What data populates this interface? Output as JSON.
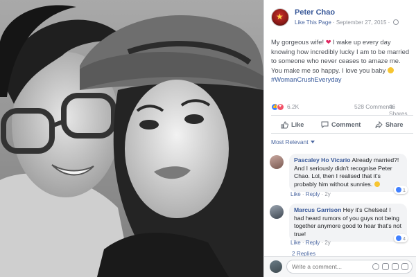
{
  "photo": {
    "alt": ""
  },
  "post": {
    "page_name": "Peter Chao",
    "like_page": "Like This Page",
    "separator": " · ",
    "date": "September 27, 2015",
    "dot": " · ",
    "text_before_heart": "My gorgeous wife! ",
    "heart": "❤",
    "text_after_heart": " I wake up every day knowing how incredibly lucky I am to be married to someone who never ceases to amaze me. You make me so happy. I love you baby ",
    "hashtag": "#WomanCrushEveryday"
  },
  "stats": {
    "reactions": "6.2K",
    "comments": "528 Comments",
    "shares": "46 Shares"
  },
  "actions": {
    "like": "Like",
    "comment": "Comment",
    "share": "Share"
  },
  "sort": {
    "label": "Most Relevant"
  },
  "comments": [
    {
      "name": "Pascaley Ho Vicario",
      "text": " Already married?! And I seriously didn't recognise Peter Chao. Lol, then I realised that it's probably him without sunnies. ",
      "like": "Like",
      "reply": "Reply",
      "time": "2y",
      "likes": "1"
    },
    {
      "name": "Marcus Garrison",
      "text": " Hey it's Chelsea! I had heard rumors of you guys not being together anymore good to hear that's not true!",
      "like": "Like",
      "reply": "Reply",
      "time": "2y",
      "likes": "4"
    }
  ],
  "replies": {
    "label": "2 Replies"
  },
  "composer": {
    "placeholder": "Write a comment..."
  },
  "colors": {
    "link": "#385898",
    "muted": "#90949c",
    "bubble": "#f2f3f5"
  }
}
